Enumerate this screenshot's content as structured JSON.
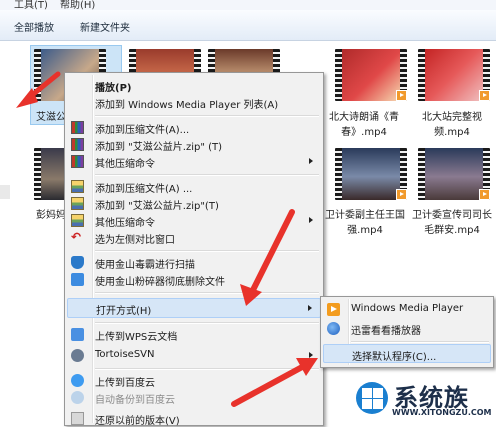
{
  "menubar": {
    "items": [
      "工具(T)",
      "帮助(H)"
    ]
  },
  "toolbar": {
    "play_all": "全部播放",
    "new_folder": "新建文件夹"
  },
  "files": [
    {
      "name": "艾滋公"
    },
    {
      "name": "北大诗朗诵《青春》.mp4"
    },
    {
      "name": "北大站完整视频.mp4"
    },
    {
      "name": "彭妈妈"
    },
    {
      "name": "卫计委副主任王国强.mp4"
    },
    {
      "name": "卫计委宣传司司长毛群安.mp4"
    }
  ],
  "context_menu": {
    "items": [
      {
        "label": "播放(P)",
        "bold": true,
        "icon": "none"
      },
      {
        "label": "添加到 Windows Media Player 列表(A)",
        "icon": "none"
      },
      {
        "label": "添加到压缩文件(A)...",
        "icon": "books-icon"
      },
      {
        "label": "添加到 \"艾滋公益片.zip\" (T)",
        "icon": "books-icon"
      },
      {
        "label": "其他压缩命令",
        "icon": "books-icon",
        "submenu": true
      },
      {
        "label": "添加到压缩文件(A) ...",
        "icon": "zip-icon"
      },
      {
        "label": "添加到 \"艾滋公益片.zip\"(T)",
        "icon": "zip-icon"
      },
      {
        "label": "其他压缩命令",
        "icon": "zip-icon",
        "submenu": true
      },
      {
        "label": "选为左侧对比窗口",
        "icon": "undo-icon"
      },
      {
        "label": "使用金山毒霸进行扫描",
        "icon": "shield-icon"
      },
      {
        "label": "使用金山粉碎器彻底删除文件",
        "icon": "shredder-icon"
      },
      {
        "label": "打开方式(H)",
        "submenu": true,
        "highlighted": true
      },
      {
        "label": "上传到WPS云文档",
        "icon": "wps-icon"
      },
      {
        "label": "TortoiseSVN",
        "icon": "svn-icon",
        "submenu": true
      },
      {
        "label": "上传到百度云",
        "icon": "cloud-icon"
      },
      {
        "label": "自动备份到百度云",
        "icon": "cloud-icon",
        "disabled": true
      },
      {
        "label": "还原以前的版本(V)",
        "icon": "history-icon"
      }
    ]
  },
  "open_with_menu": {
    "items": [
      {
        "label": "Windows Media Player",
        "icon": "wmp-icon"
      },
      {
        "label": "迅雷看看播放器",
        "icon": "xunlei-icon"
      },
      {
        "label": "选择默认程序(C)...",
        "highlighted": true
      }
    ]
  },
  "watermark": {
    "brand": "系统族",
    "url": "WWW.XITONGZU.COM"
  },
  "colors": {
    "arrow": "#e8322b",
    "selection": "#cce4f7",
    "highlight": "#d6e6f7"
  }
}
